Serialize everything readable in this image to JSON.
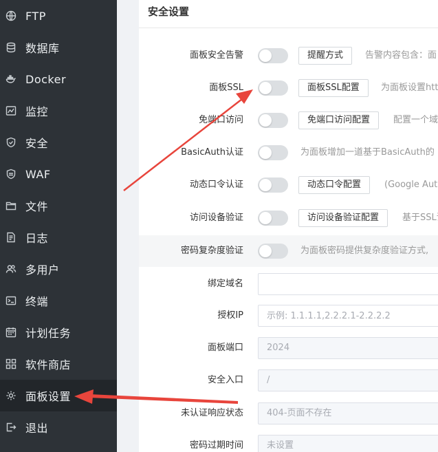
{
  "sidebar": {
    "items": [
      {
        "label": "FTP",
        "icon": "globe-icon"
      },
      {
        "label": "数据库",
        "icon": "database-icon"
      },
      {
        "label": "Docker",
        "icon": "docker-icon"
      },
      {
        "label": "监控",
        "icon": "monitor-icon"
      },
      {
        "label": "安全",
        "icon": "shield-icon"
      },
      {
        "label": "WAF",
        "icon": "waf-shield-icon"
      },
      {
        "label": "文件",
        "icon": "folder-icon"
      },
      {
        "label": "日志",
        "icon": "log-icon"
      },
      {
        "label": "多用户",
        "icon": "users-icon"
      },
      {
        "label": "终端",
        "icon": "terminal-icon"
      },
      {
        "label": "计划任务",
        "icon": "calendar-icon"
      },
      {
        "label": "软件商店",
        "icon": "apps-icon"
      },
      {
        "label": "面板设置",
        "icon": "gear-icon",
        "active": true
      },
      {
        "label": "退出",
        "icon": "logout-icon"
      }
    ]
  },
  "panel": {
    "title": "安全设置",
    "rows": [
      {
        "label": "面板安全告警",
        "button": "提醒方式",
        "desc": "告警内容包含：面"
      },
      {
        "label": "面板SSL",
        "button": "面板SSL配置",
        "desc": "为面板设置htt"
      },
      {
        "label": "免端口访问",
        "button": "免端口访问配置",
        "desc": "配置一个域"
      },
      {
        "label": "BasicAuth认证",
        "desc": "为面板增加一道基于BasicAuth的"
      },
      {
        "label": "动态口令认证",
        "button": "动态口令配置",
        "desc": "(Google Aut"
      },
      {
        "label": "访问设备验证",
        "button": "访问设备验证配置",
        "desc": "基于SSL证"
      },
      {
        "label": "密码复杂度验证",
        "desc": "为面板密码提供复杂度验证方式,"
      }
    ],
    "fields": [
      {
        "label": "绑定域名",
        "value": "",
        "placeholder": ""
      },
      {
        "label": "授权IP",
        "value": "",
        "placeholder": "示例: 1.1.1.1,2.2.2.1-2.2.2.2"
      },
      {
        "label": "面板端口",
        "value": "2024"
      },
      {
        "label": "安全入口",
        "value": "/"
      },
      {
        "label": "未认证响应状态",
        "value": "404-页面不存在"
      },
      {
        "label": "密码过期时间",
        "value": "未设置"
      }
    ]
  },
  "colors": {
    "sidebar_bg": "#2d3237",
    "active_bg": "#22262a",
    "annotation_arrow": "#e8453c",
    "toggle_off": "#dcdfe2"
  }
}
